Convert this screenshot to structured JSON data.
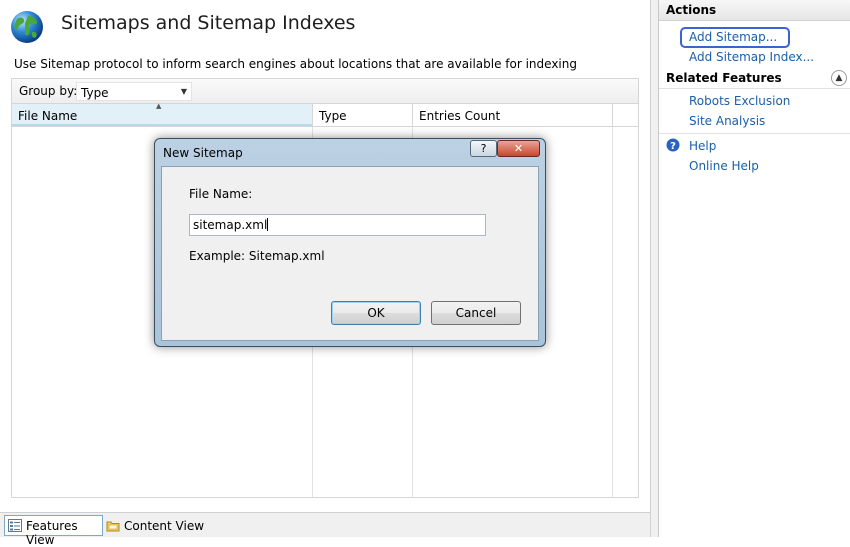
{
  "main": {
    "title": "Sitemaps and Sitemap Indexes",
    "description": "Use Sitemap protocol to inform search engines about locations that are available for indexing",
    "group_by_label": "Group by:",
    "group_by_value": "Type",
    "columns": [
      "File Name",
      "Type",
      "Entries Count"
    ]
  },
  "bottom_tabs": {
    "features_view": "Features View",
    "content_view": "Content View"
  },
  "actions_pane": {
    "actions_header": "Actions",
    "add_sitemap": "Add Sitemap...",
    "add_sitemap_index": "Add Sitemap Index...",
    "related_header": "Related Features",
    "robots_exclusion": "Robots Exclusion",
    "site_analysis": "Site Analysis",
    "help": "Help",
    "online_help": "Online Help"
  },
  "dialog": {
    "title": "New Sitemap",
    "help_button": "?",
    "close_button": "✕",
    "file_name_label": "File Name:",
    "file_name_value": "sitemap.xml",
    "example_text": "Example: Sitemap.xml",
    "ok_label": "OK",
    "cancel_label": "Cancel"
  },
  "colors": {
    "link": "#1a5fa8",
    "highlight_ring": "#3b63d4",
    "dialog_frame": "#bcd1e3",
    "close_red": "#c8462f"
  }
}
